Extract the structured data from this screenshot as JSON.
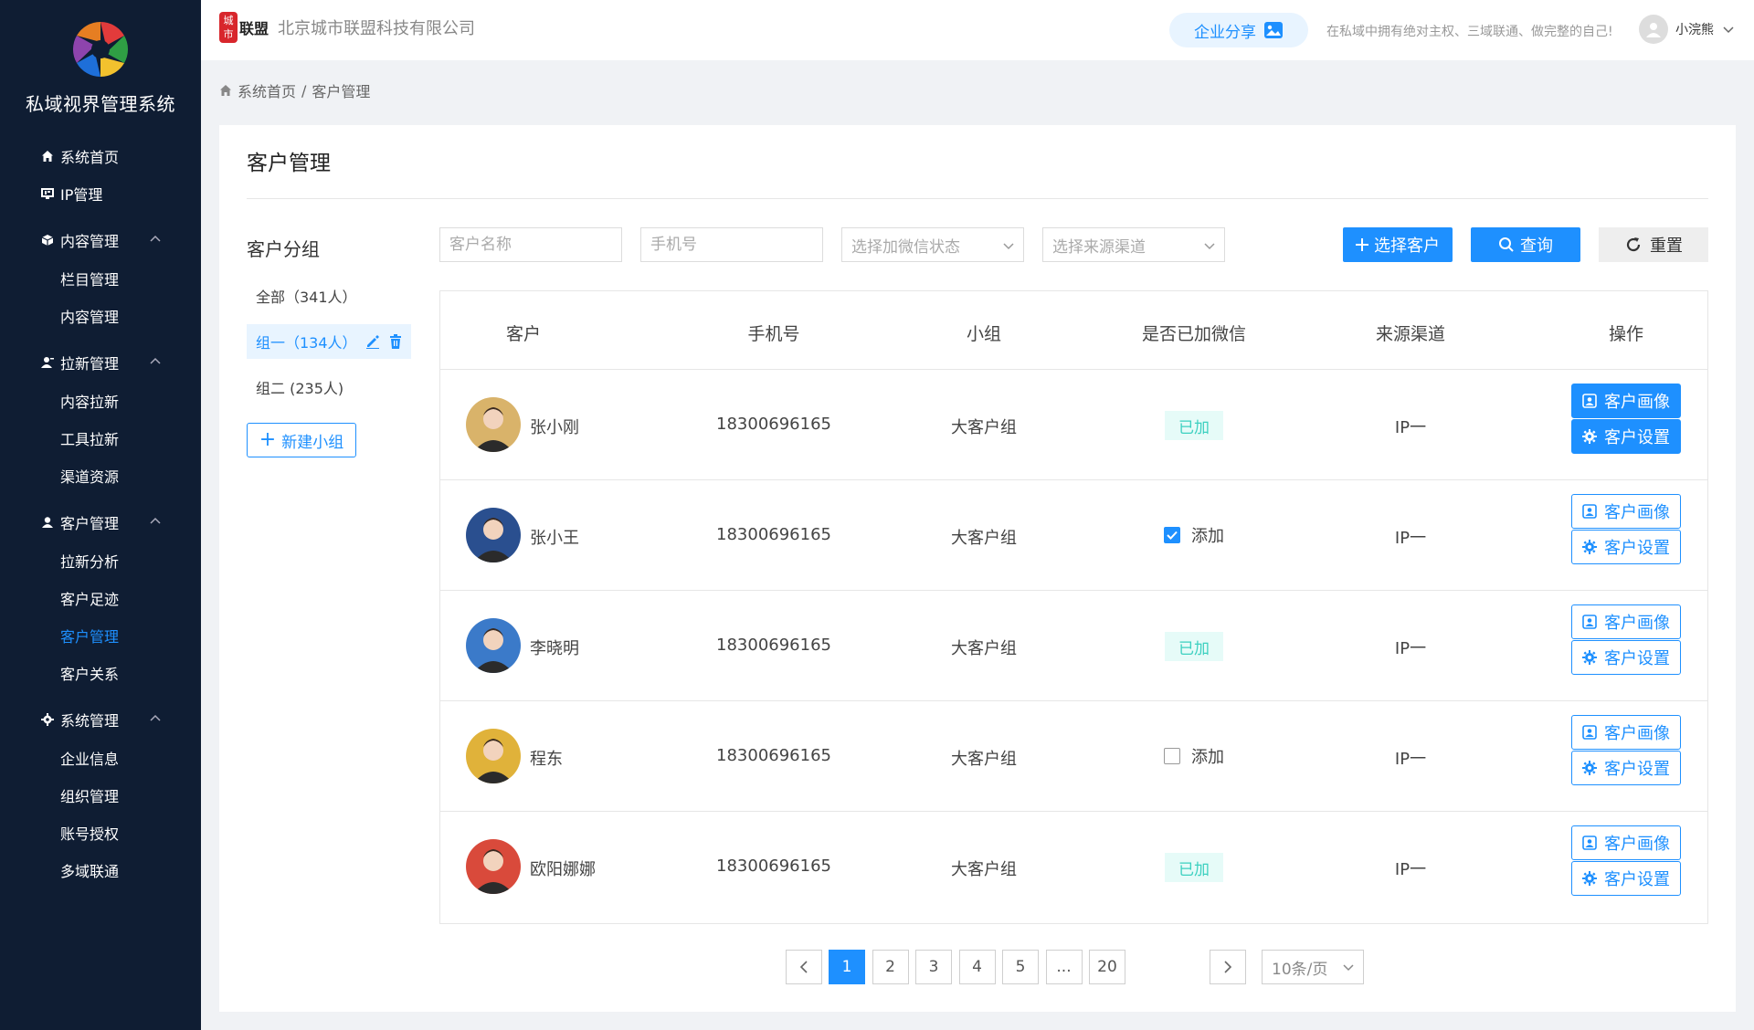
{
  "app": {
    "title": "私域视界管理系统"
  },
  "sidebar": {
    "items": [
      {
        "label": "系统首页",
        "icon": "home-icon"
      },
      {
        "label": "IP管理",
        "icon": "ip-icon"
      }
    ],
    "groups": [
      {
        "label": "内容管理",
        "icon": "cube-icon",
        "children": [
          "栏目管理",
          "内容管理"
        ]
      },
      {
        "label": "拉新管理",
        "icon": "user-add-icon",
        "children": [
          "内容拉新",
          "工具拉新",
          "渠道资源"
        ]
      },
      {
        "label": "客户管理",
        "icon": "customers-icon",
        "children": [
          "拉新分析",
          "客户足迹",
          "客户管理",
          "客户关系"
        ]
      },
      {
        "label": "系统管理",
        "icon": "gear-icon",
        "children": [
          "企业信息",
          "组织管理",
          "账号授权",
          "多域联通"
        ]
      }
    ],
    "active_item": "客户管理"
  },
  "header": {
    "brand_badge": "城市",
    "brand_name": "联盟",
    "company": "北京城市联盟科技有限公司",
    "share_label": "企业分享",
    "slogan": "在私域中拥有绝对主权、三域联通、做完整的自己!",
    "user_name": "小浣熊"
  },
  "breadcrumb": {
    "home": "系统首页",
    "separator": "/",
    "current": "客户管理"
  },
  "page": {
    "title": "客户管理"
  },
  "groups_panel": {
    "title": "客户分组",
    "items": [
      "全部（341人）",
      "组一（134人）",
      "组二 (235人)"
    ],
    "active_index": 1,
    "new_group_label": "新建小组"
  },
  "filters": {
    "name_placeholder": "客户名称",
    "phone_placeholder": "手机号",
    "wechat_status_placeholder": "选择加微信状态",
    "source_placeholder": "选择来源渠道",
    "select_customer_label": "选择客户",
    "query_label": "查询",
    "reset_label": "重置"
  },
  "table": {
    "columns": [
      "客户",
      "手机号",
      "小组",
      "是否已加微信",
      "来源渠道",
      "操作"
    ],
    "rows": [
      {
        "name": "张小刚",
        "phone": "18300696165",
        "group": "大客户组",
        "wechat": "added",
        "wechat_label": "已加",
        "source": "IP一",
        "avatar_color": "#d9b36a",
        "solid_buttons": true
      },
      {
        "name": "张小王",
        "phone": "18300696165",
        "group": "大客户组",
        "wechat": "checked",
        "wechat_label": "添加",
        "source": "IP一",
        "avatar_color": "#2a4f8f",
        "solid_buttons": false
      },
      {
        "name": "李晓明",
        "phone": "18300696165",
        "group": "大客户组",
        "wechat": "added",
        "wechat_label": "已加",
        "source": "IP一",
        "avatar_color": "#3b7ac9",
        "solid_buttons": false
      },
      {
        "name": "程东",
        "phone": "18300696165",
        "group": "大客户组",
        "wechat": "unchecked",
        "wechat_label": "添加",
        "source": "IP一",
        "avatar_color": "#e0b23a",
        "solid_buttons": false
      },
      {
        "name": "欧阳娜娜",
        "phone": "18300696165",
        "group": "大客户组",
        "wechat": "added",
        "wechat_label": "已加",
        "source": "IP一",
        "avatar_color": "#d94a3b",
        "solid_buttons": false
      }
    ],
    "portrait_label": "客户画像",
    "settings_label": "客户设置"
  },
  "pagination": {
    "pages": [
      "1",
      "2",
      "3",
      "4",
      "5",
      "...",
      "20"
    ],
    "current": "1",
    "page_size": "10条/页"
  },
  "colors": {
    "primary": "#1e90ff",
    "sidebar_bg": "#0f1d33",
    "tag_bg": "#e6fbf8",
    "tag_text": "#3cd0c0"
  }
}
